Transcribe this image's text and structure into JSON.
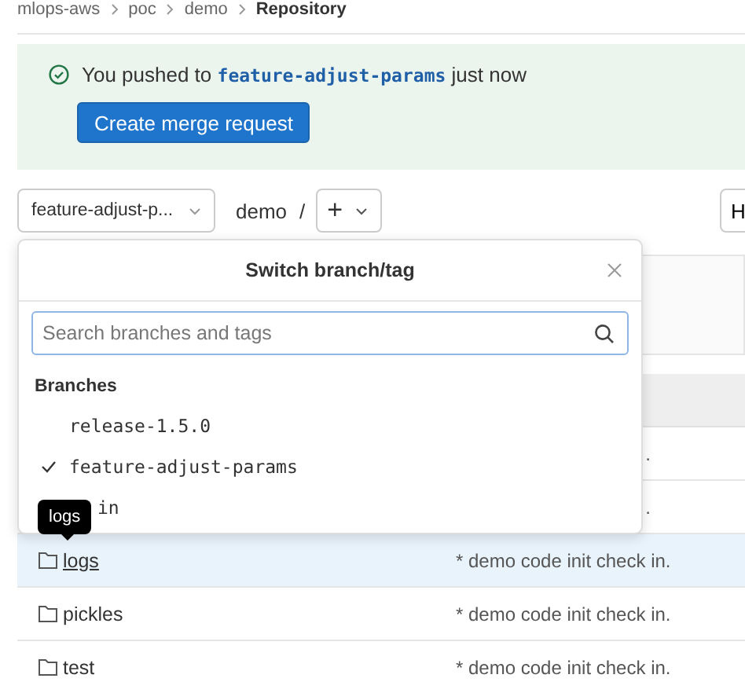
{
  "breadcrumb": [
    {
      "label": "mlops-aws",
      "current": false
    },
    {
      "label": "poc",
      "current": false
    },
    {
      "label": "demo",
      "current": false
    },
    {
      "label": "Repository",
      "current": true
    }
  ],
  "banner": {
    "message": "You pushed to **feature-adjust-params** just now",
    "button": "Create merge request"
  },
  "toolbar": {
    "branch": "feature-adjust-p...",
    "path": "demo",
    "separator": "/",
    "add": "+",
    "right_button": "H"
  },
  "rows": [
    {
      "kind": "covered",
      "commit": "."
    },
    {
      "kind": "covered",
      "commit": "."
    },
    {
      "kind": "folder",
      "name": "logs",
      "commit": "* demo code init check in.",
      "hovered": true
    },
    {
      "kind": "folder",
      "name": "pickles",
      "commit": "* demo code init check in.",
      "hovered": false
    },
    {
      "kind": "folder",
      "name": "test",
      "commit": "* demo code init check in.",
      "hovered": false
    }
  ],
  "dropdown": {
    "title": "Switch branch/tag",
    "search_placeholder": "Search branches and tags",
    "section": "Branches",
    "items": [
      {
        "kind": "branch",
        "label": "release-1.5.0",
        "selected": false
      },
      {
        "kind": "branch",
        "label": "feature-adjust-params",
        "selected": true
      },
      {
        "kind": "covered",
        "label": "in"
      }
    ]
  },
  "tooltip": "logs"
}
